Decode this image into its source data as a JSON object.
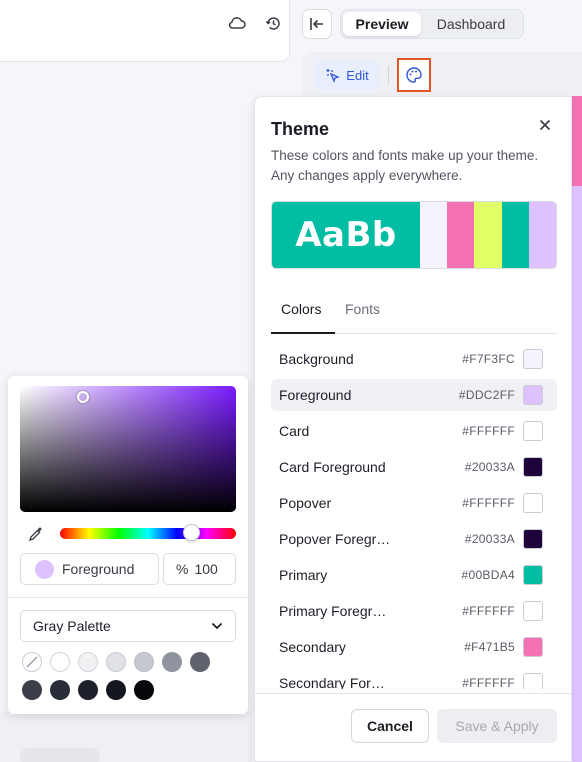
{
  "toolbar": {
    "tabs": [
      "Preview",
      "Dashboard"
    ],
    "edit_label": "Edit"
  },
  "theme": {
    "title": "Theme",
    "description": "These colors and fonts make up your theme. Any changes apply everywhere.",
    "preview_text": "AaBb",
    "preview_colors": [
      "#00BDA4",
      "#F7F3FC",
      "#F471B5",
      "#E1FF66",
      "#00BDA4",
      "#DDC2FF"
    ],
    "tabs": [
      "Colors",
      "Fonts"
    ],
    "colors": [
      {
        "name": "Background",
        "hex": "#F7F3FC"
      },
      {
        "name": "Foreground",
        "hex": "#DDC2FF"
      },
      {
        "name": "Card",
        "hex": "#FFFFFF"
      },
      {
        "name": "Card Foreground",
        "hex": "#20033A"
      },
      {
        "name": "Popover",
        "hex": "#FFFFFF"
      },
      {
        "name": "Popover Foregr…",
        "hex": "#20033A"
      },
      {
        "name": "Primary",
        "hex": "#00BDA4"
      },
      {
        "name": "Primary Foregr…",
        "hex": "#FFFFFF"
      },
      {
        "name": "Secondary",
        "hex": "#F471B5"
      },
      {
        "name": "Secondary For…",
        "hex": "#FFFFFF"
      }
    ],
    "cancel_label": "Cancel",
    "apply_label": "Save & Apply"
  },
  "picker": {
    "field_label": "Foreground",
    "field_color": "#DDC2FF",
    "opacity_symbol": "%",
    "opacity_value": "100",
    "palette_label": "Gray Palette",
    "palette_swatches": [
      "none",
      "#FFFFFF",
      "#F1F2F4",
      "#E0E2E7",
      "#C6C9D0",
      "#8F939D",
      "#5F636D",
      "#3B3F49",
      "#2A2E38",
      "#1D212B",
      "#13161E",
      "#05070B"
    ]
  }
}
